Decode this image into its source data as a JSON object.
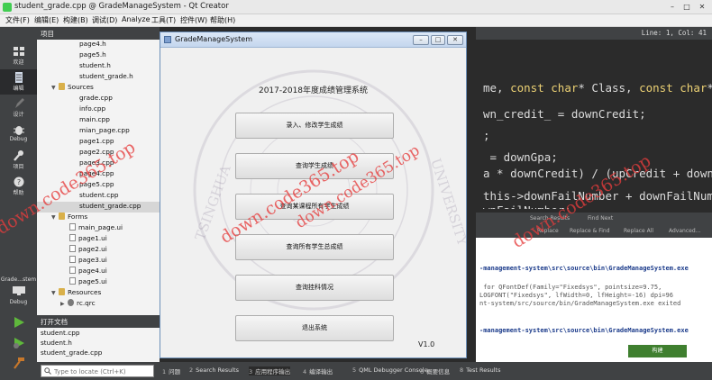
{
  "window": {
    "title": "student_grade.cpp @ GradeManageSystem - Qt Creator"
  },
  "menubar": [
    "文件(F)",
    "编辑(E)",
    "构建(B)",
    "调试(D)",
    "Analyze",
    "工具(T)",
    "控件(W)",
    "帮助(H)"
  ],
  "modes": [
    "欢迎",
    "编辑",
    "设计",
    "Debug",
    "项目",
    "帮助"
  ],
  "run_target": {
    "name": "Grade…stem",
    "mode": "Debug"
  },
  "project_pane": {
    "title": "项目",
    "tree": [
      {
        "label": "page4.h",
        "kind": "file"
      },
      {
        "label": "page5.h",
        "kind": "file"
      },
      {
        "label": "student.h",
        "kind": "file"
      },
      {
        "label": "student_grade.h",
        "kind": "file"
      },
      {
        "label": "Sources",
        "kind": "folder"
      },
      {
        "label": "grade.cpp",
        "kind": "file"
      },
      {
        "label": "info.cpp",
        "kind": "file"
      },
      {
        "label": "main.cpp",
        "kind": "file"
      },
      {
        "label": "mian_page.cpp",
        "kind": "file"
      },
      {
        "label": "page1.cpp",
        "kind": "file"
      },
      {
        "label": "page2.cpp",
        "kind": "file"
      },
      {
        "label": "page3.cpp",
        "kind": "file"
      },
      {
        "label": "page4.cpp",
        "kind": "file"
      },
      {
        "label": "page5.cpp",
        "kind": "file"
      },
      {
        "label": "student.cpp",
        "kind": "file"
      },
      {
        "label": "student_grade.cpp",
        "kind": "file",
        "selected": true
      },
      {
        "label": "Forms",
        "kind": "folder"
      },
      {
        "label": "main_page.ui",
        "kind": "ui"
      },
      {
        "label": "page1.ui",
        "kind": "ui"
      },
      {
        "label": "page2.ui",
        "kind": "ui"
      },
      {
        "label": "page3.ui",
        "kind": "ui"
      },
      {
        "label": "page4.ui",
        "kind": "ui"
      },
      {
        "label": "page5.ui",
        "kind": "ui"
      },
      {
        "label": "Resources",
        "kind": "folder"
      },
      {
        "label": "rc.qrc",
        "kind": "qrc"
      }
    ]
  },
  "open_documents": {
    "title": "打开文档",
    "items": [
      "student.cpp",
      "student.h",
      "student_grade.cpp"
    ]
  },
  "editor": {
    "cursor": "Line: 1, Col: 41",
    "lines": [
      [
        {
          "t": "me, "
        },
        {
          "t": "const char",
          "kw": true
        },
        {
          "t": "* Class, "
        },
        {
          "t": "const char",
          "kw": true
        },
        {
          "t": "* num"
        }
      ],
      [
        {
          "t": "wn_credit_ = downCredit;"
        }
      ],
      [
        {
          "t": ";"
        }
      ],
      [
        {
          "t": " = downGpa;"
        }
      ],
      [
        {
          "t": "a * downCredit) / (upCredit + downCred"
        }
      ],
      [
        {
          "t": "this->downFailNumber + downFailNumber;"
        }
      ],
      [
        {
          "t": "wnFailNumber;"
        }
      ]
    ]
  },
  "output_tabs": [
    "Search Results",
    "Find Next",
    "Replace",
    "Replace & Find",
    "Replace All",
    "Advanced…"
  ],
  "app_output": [
    {
      "text": "-management-system\\src\\source\\bin\\GradeManageSystem.exe",
      "style": "blue"
    },
    {
      "text": " for QFontDef(Family=\"Fixedsys\", pointsize=9.75,",
      "style": "gray"
    },
    {
      "text": "LOGFONT(\"Fixedsys\", lfWidth=0, lfHeight=-16) dpi=96",
      "style": "gray"
    },
    {
      "text": "nt-system/src/source/bin/GradeManageSystem.exe exited",
      "style": "gray"
    },
    {
      "text": "-management-system\\src\\source\\bin\\GradeManageSystem.exe",
      "style": "blue"
    }
  ],
  "progress": {
    "label": "构建"
  },
  "statusbar": {
    "locator_placeholder": "Type to locate (Ctrl+K)",
    "tabs": [
      {
        "num": "1",
        "label": "问题"
      },
      {
        "num": "2",
        "label": "Search Results"
      },
      {
        "num": "3",
        "label": "应用程序输出"
      },
      {
        "num": "4",
        "label": "编译输出"
      },
      {
        "num": "5",
        "label": "QML Debugger Console"
      },
      {
        "num": "6",
        "label": "概要信息"
      },
      {
        "num": "8",
        "label": "Test Results"
      }
    ]
  },
  "dialog": {
    "title": "GradeManageSystem",
    "heading": "2017-2018年度成绩管理系统",
    "buttons": [
      "录入、修改学生成绩",
      "查询学生成绩",
      "查询某课程所有学生成绩",
      "查询所有学生总成绩",
      "查询挂科情况",
      "退出系统"
    ],
    "version": "V1.0",
    "seal_text": {
      "left": "TSINGHUA",
      "right": "UNIVERSITY"
    }
  },
  "watermark": [
    "down.code365.top",
    "down.code365.top",
    "down.code365.top",
    "down.code365.top"
  ],
  "colors": {
    "ide_dark": "#404244",
    "editor_bg": "#2b2b2b",
    "keyword": "#ecd174",
    "watermark": "#e63c3c",
    "dialog_border": "#6c8fb8"
  }
}
